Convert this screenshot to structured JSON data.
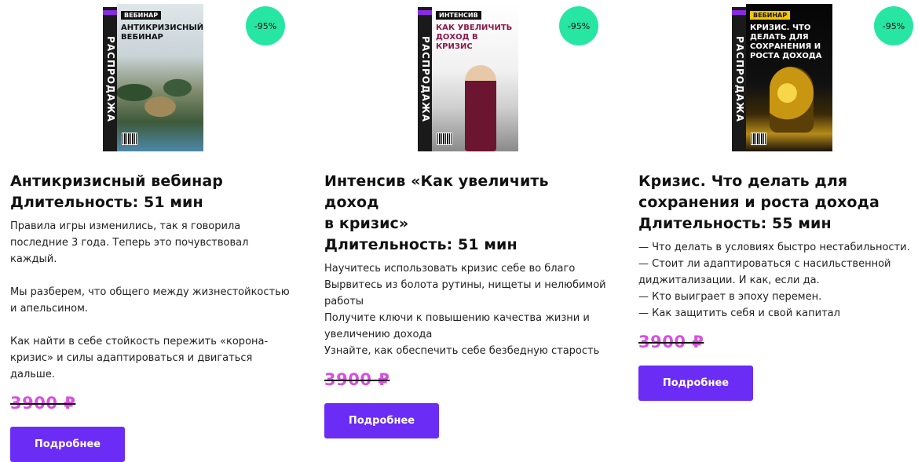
{
  "products": [
    {
      "discount": "-95%",
      "cover": {
        "spine": "РАСПРОДАЖА",
        "badge": "ВЕБИНАР",
        "title": "АНТИКРИЗИСНЫЙ ВЕБИНАР"
      },
      "title_line1": "Антикризисный вебинар",
      "title_line2": "Длительность: 51 мин",
      "desc": [
        "Правила игры изменились, так я говорила",
        "последние 3 года. Теперь это почувствовал каждый.",
        "",
        "Мы разберем, что общего между жизнестойкостью",
        "и апельсином.",
        "",
        "Как найти в себе стойкость пережить «корона-",
        "кризис» и силы адаптироваться и двигаться",
        "дальше."
      ],
      "price": "3900 ₽",
      "button": "Подробнее"
    },
    {
      "discount": "-95%",
      "cover": {
        "spine": "РАСПРОДАЖА",
        "badge": "ИНТЕНСИВ",
        "title": "КАК УВЕЛИЧИТЬ ДОХОД В КРИЗИС"
      },
      "title_line1": "Интенсив «Как увеличить доход",
      "title_line2": "в кризис»",
      "title_line3": "Длительность: 51 мин",
      "desc": [
        "Научитесь использовать кризис себе во благо",
        "Вырвитесь из болота рутины, нищеты и нелюбимой",
        "работы",
        "Получите ключи к повышению качества жизни и",
        "увеличению дохода",
        "Узнайте, как обеспечить себе безбедную старость"
      ],
      "price": "3900 ₽",
      "button": "Подробнее"
    },
    {
      "discount": "-95%",
      "cover": {
        "spine": "РАСПРОДАЖА",
        "badge": "ВЕБИНАР",
        "title": "КРИЗИС. ЧТО ДЕЛАТЬ ДЛЯ СОХРАНЕНИЯ И РОСТА ДОХОДА"
      },
      "title_line1": "Кризис. Что делать для",
      "title_line2": "сохранения и роста дохода",
      "title_line3": "Длительность: 55 мин",
      "desc": [
        "— Что делать в условиях быстро нестабильности.",
        "— Стоит ли адаптироваться с насильственной",
        "диджитализации. И как, если да.",
        "— Кто выиграет в эпоху перемен.",
        "— Как защитить себя и свой капитал"
      ],
      "price": "3900 ₽",
      "button": "Подробнее"
    }
  ]
}
